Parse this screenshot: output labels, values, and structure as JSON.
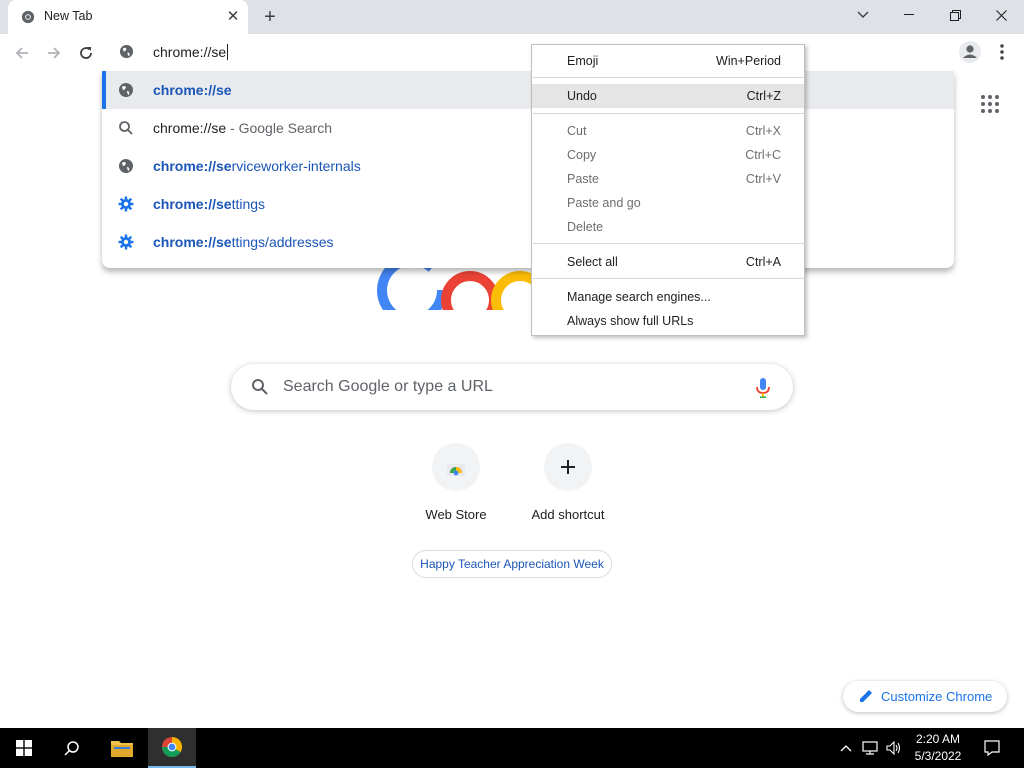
{
  "tab": {
    "title": "New Tab",
    "close_glyph": "✕",
    "new_tab_glyph": "+"
  },
  "omnibox": {
    "text": "chrome://se"
  },
  "suggestions": [
    {
      "icon": "globe-icon",
      "match": "chrome://se",
      "rest": "",
      "suffix": "",
      "selected": true
    },
    {
      "icon": "search-icon",
      "match": "",
      "rest": "chrome://se",
      "suffix": " - Google Search",
      "selected": false
    },
    {
      "icon": "globe-icon",
      "match": "chrome://se",
      "rest": "rviceworker-internals",
      "suffix": "",
      "selected": false
    },
    {
      "icon": "gear-icon",
      "match": "chrome://se",
      "rest": "ttings",
      "suffix": "",
      "selected": false
    },
    {
      "icon": "gear-icon",
      "match": "chrome://se",
      "rest": "ttings/addresses",
      "suffix": "",
      "selected": false
    }
  ],
  "context_menu": {
    "emoji": {
      "label": "Emoji",
      "accel": "Win+Period"
    },
    "undo": {
      "label": "Undo",
      "accel": "Ctrl+Z"
    },
    "cut": {
      "label": "Cut",
      "accel": "Ctrl+X"
    },
    "copy": {
      "label": "Copy",
      "accel": "Ctrl+C"
    },
    "paste": {
      "label": "Paste",
      "accel": "Ctrl+V"
    },
    "paste_go": {
      "label": "Paste and go",
      "accel": ""
    },
    "delete": {
      "label": "Delete",
      "accel": ""
    },
    "select_all": {
      "label": "Select all",
      "accel": "Ctrl+A"
    },
    "manage_engines": {
      "label": "Manage search engines...",
      "accel": ""
    },
    "show_urls": {
      "label": "Always show full URLs",
      "accel": ""
    }
  },
  "search": {
    "placeholder": "Search Google or type a URL"
  },
  "shortcuts": [
    {
      "label": "Web Store",
      "icon": "webstore-icon"
    },
    {
      "label": "Add shortcut",
      "icon": "plus-icon"
    }
  ],
  "chip": {
    "label": "Happy Teacher Appreciation Week"
  },
  "customize": {
    "label": "Customize Chrome"
  },
  "taskbar": {
    "time": "2:20 AM",
    "date": "5/3/2022"
  },
  "colors": {
    "link": "#1a56b8",
    "accent": "#1a73e8",
    "tabstrip": "#dee1e6"
  }
}
